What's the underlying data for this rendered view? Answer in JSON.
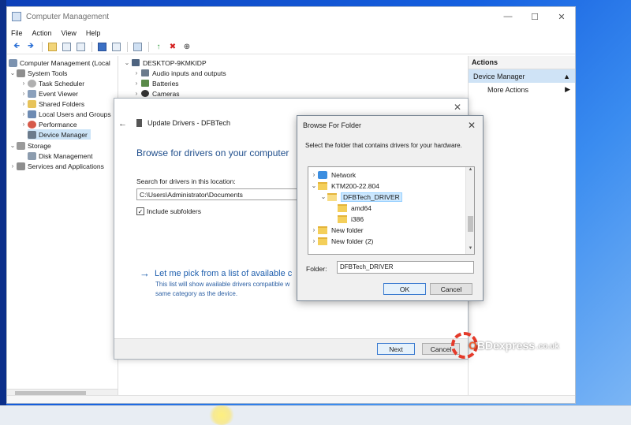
{
  "window": {
    "title": "Computer Management",
    "controls": {
      "minimize": "—",
      "maximize": "☐",
      "close": "✕"
    }
  },
  "menu": [
    "File",
    "Action",
    "View",
    "Help"
  ],
  "toolbar": {
    "back": "🡸",
    "forward": "🡺",
    "enable": "↑",
    "delete": "✖",
    "download": "⊕"
  },
  "tree": {
    "root": "Computer Management (Local",
    "items": [
      {
        "label": "System Tools"
      },
      {
        "label": "Task Scheduler"
      },
      {
        "label": "Event Viewer"
      },
      {
        "label": "Shared Folders"
      },
      {
        "label": "Local Users and Groups"
      },
      {
        "label": "Performance"
      },
      {
        "label": "Device Manager"
      },
      {
        "label": "Storage"
      },
      {
        "label": "Disk Management"
      },
      {
        "label": "Services and Applications"
      }
    ]
  },
  "devices": {
    "root": "DESKTOP-9KMKIDP",
    "items": [
      "Audio inputs and outputs",
      "Batteries",
      "Cameras"
    ]
  },
  "actions": {
    "header": "Actions",
    "device_manager": "Device Manager",
    "more_actions": "More Actions"
  },
  "update_dialog": {
    "title": "Update Drivers - DFBTech",
    "heading": "Browse for drivers on your computer",
    "search_label": "Search for drivers in this location:",
    "path": "C:\\Users\\Administrator\\Documents",
    "include_subfolders": "Include subfolders",
    "pick_link": "Let me pick from a list of available c",
    "pick_desc": "This list will show available drivers compatible w same category as the device.",
    "next": "Next",
    "cancel": "Cancel"
  },
  "browse_dialog": {
    "title": "Browse For Folder",
    "description": "Select the folder that contains drivers for your hardware.",
    "folders": [
      {
        "label": "Network"
      },
      {
        "label": "KTM200-22.804"
      },
      {
        "label": "DFBTech_DRIVER"
      },
      {
        "label": "amd64"
      },
      {
        "label": "i386"
      },
      {
        "label": "New folder"
      },
      {
        "label": "New folder (2)"
      }
    ],
    "folder_label": "Folder:",
    "folder_value": "DFBTech_DRIVER",
    "ok": "OK",
    "cancel": "Cancel"
  },
  "watermark": {
    "brand_o": "O",
    "brand_rest": "BDexpress",
    "domain": ".co.uk"
  }
}
